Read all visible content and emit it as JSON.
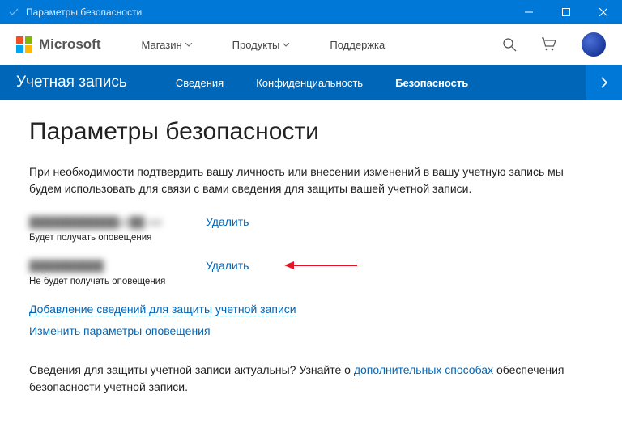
{
  "titlebar": {
    "title": "Параметры безопасности"
  },
  "toprow": {
    "brand": "Microsoft",
    "nav": {
      "store": "Магазин",
      "products": "Продукты",
      "support": "Поддержка"
    }
  },
  "subnav": {
    "brand": "Учетная запись",
    "tabs": {
      "info": "Сведения",
      "privacy": "Конфиденциальность",
      "security": "Безопасность"
    }
  },
  "page": {
    "heading": "Параметры безопасности",
    "lead": "При необходимости подтвердить вашу личность или внесении изменений в вашу учетную запись мы будем использовать для связи с вами сведения для защиты вашей учетной записи.",
    "entries": [
      {
        "masked": "████████████@██.net",
        "action": "Удалить",
        "note": "Будет получать оповещения"
      },
      {
        "masked": "██████████",
        "action": "Удалить",
        "note": "Не будет получать оповещения"
      }
    ],
    "link_add": "Добавление сведений для защиты учетной записи",
    "link_notify": "Изменить параметры оповещения",
    "footer_pre": "Сведения для защиты учетной записи актуальны? Узнайте о ",
    "footer_link": "дополнительных способах",
    "footer_post": " обеспечения безопасности учетной записи."
  }
}
